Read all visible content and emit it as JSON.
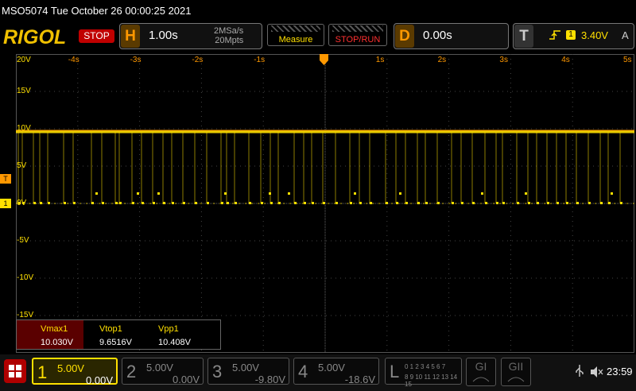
{
  "header": {
    "title": "MSO5074  Tue October 26 00:00:25 2021",
    "logo": "RIGOL",
    "run_state": "STOP"
  },
  "horizontal": {
    "letter": "H",
    "timebase": "1.00s",
    "sample_rate": "2MSa/s",
    "memory_depth": "20Mpts"
  },
  "buttons": {
    "measure": "Measure",
    "stop_run": "STOP/RUN"
  },
  "delay": {
    "letter": "D",
    "value": "0.00s"
  },
  "trigger": {
    "letter": "T",
    "edge_icon": "rising-edge-icon",
    "source": "1",
    "level": "3.40V",
    "mode": "A"
  },
  "time_ticks": [
    "-4s",
    "-3s",
    "-2s",
    "-1s",
    "",
    "1s",
    "2s",
    "3s",
    "4s",
    "5s"
  ],
  "volt_ticks": [
    "20V",
    "15V",
    "10V",
    "5V",
    "0V",
    "-5V",
    "-10V",
    "-15V"
  ],
  "markers": {
    "trigger_level": "T",
    "ch1_ground": "1"
  },
  "measurements": [
    {
      "label": "Vmax1",
      "value": "10.030V"
    },
    {
      "label": "Vtop1",
      "value": "9.6516V"
    },
    {
      "label": "Vpp1",
      "value": "10.408V"
    }
  ],
  "channels": [
    {
      "num": "1",
      "scale": "5.00V",
      "offset": "0.00V"
    },
    {
      "num": "2",
      "scale": "5.00V",
      "offset": "0.00V"
    },
    {
      "num": "3",
      "scale": "5.00V",
      "offset": "-9.80V"
    },
    {
      "num": "4",
      "scale": "5.00V",
      "offset": "-18.6V"
    }
  ],
  "logic": {
    "letter": "L",
    "row1": "0 1 2 3 4 5 6 7",
    "row2": "8 9 10 11 12 13 14 15"
  },
  "decoders": [
    "GI",
    "GII"
  ],
  "status": {
    "clock": "23:59",
    "usb_icon": "usb-icon",
    "speaker_icon": "speaker-icon"
  },
  "colors": {
    "ch1": "#ffe000",
    "accent": "#ff9800",
    "stop": "#c00000"
  }
}
